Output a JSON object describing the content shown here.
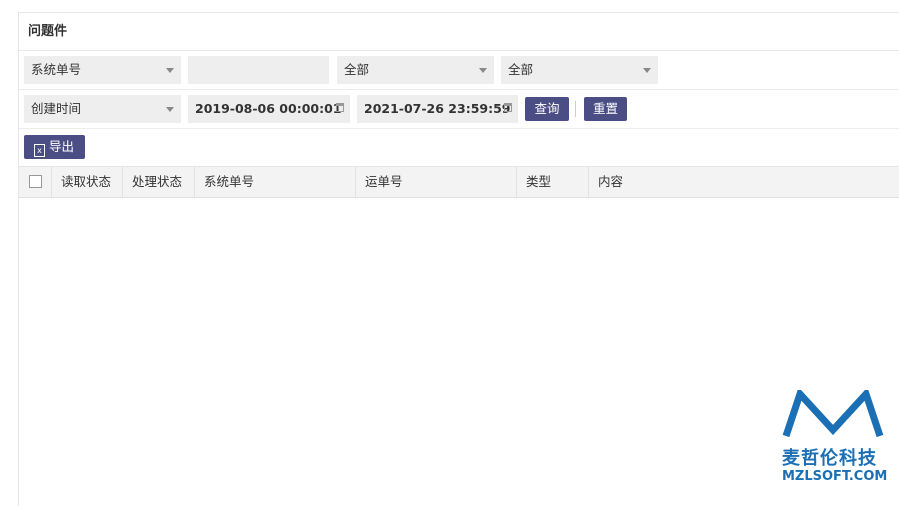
{
  "panel": {
    "title": "问题件"
  },
  "filters": {
    "row1": {
      "field_select": "系统单号",
      "keyword_value": "",
      "select2": "全部",
      "select3": "全部"
    },
    "row2": {
      "time_select": "创建时间",
      "start_date": "2019-08-06 00:00:01",
      "end_date": "2021-07-26 23:59:59",
      "query_label": "查询",
      "reset_label": "重置"
    }
  },
  "toolbar": {
    "export_label": "导出",
    "export_icon": "excel-icon"
  },
  "table": {
    "columns": [
      "读取状态",
      "处理状态",
      "系统单号",
      "运单号",
      "类型",
      "内容"
    ],
    "rows": []
  },
  "watermark": {
    "cn": "麦哲伦科技",
    "en": "MZLSOFT.COM",
    "color": "#1b6fb4"
  }
}
